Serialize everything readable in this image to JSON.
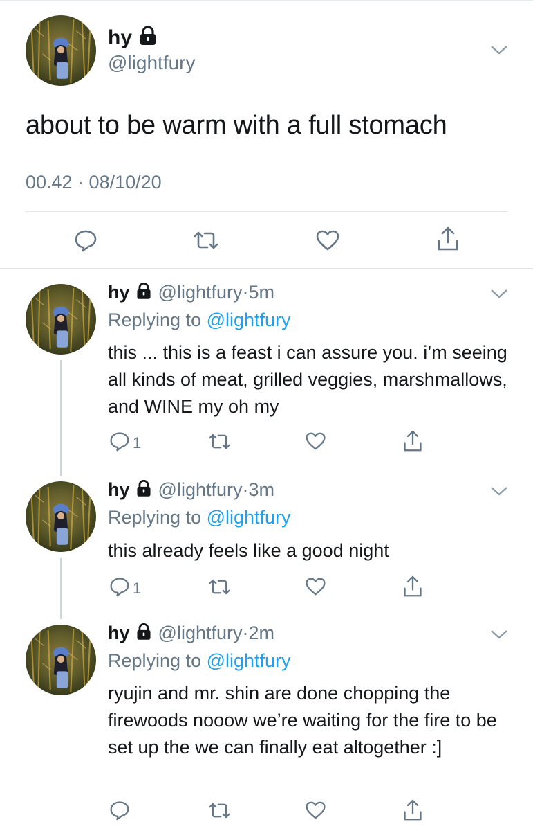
{
  "tweet": {
    "name": "hy",
    "handle": "@lightfury",
    "text": "about to be warm with a full stomach",
    "timestamp": "00.42 · 08/10/20"
  },
  "replies": [
    {
      "name": "hy",
      "handle": "@lightfury",
      "sep": "·",
      "time": "5m",
      "replying_prefix": "Replying to",
      "replying_to": "@lightfury",
      "text": "this ... this is a feast i can assure you. i’m seeing all kinds of meat, grilled veggies, marshmallows, and WINE my oh my",
      "reply_count": "1"
    },
    {
      "name": "hy",
      "handle": "@lightfury",
      "sep": "·",
      "time": "3m",
      "replying_prefix": "Replying to",
      "replying_to": "@lightfury",
      "text": "this already feels like a good night",
      "reply_count": "1"
    },
    {
      "name": "hy",
      "handle": "@lightfury",
      "sep": "·",
      "time": "2m",
      "replying_prefix": "Replying to",
      "replying_to": "@lightfury",
      "text": "ryujin and mr. shin are done chopping the firewoods nooow we’re waiting for the fire to be set up the we can finally eat altogether :]",
      "reply_count": ""
    }
  ],
  "icons": {
    "lock": "lock-icon",
    "chevron": "chevron-down-icon",
    "reply": "reply-icon",
    "retweet": "retweet-icon",
    "like": "heart-icon",
    "share": "share-icon"
  },
  "colors": {
    "text": "#14171a",
    "secondary": "#657786",
    "link": "#1da1f2",
    "divider": "#e1e8ed"
  }
}
